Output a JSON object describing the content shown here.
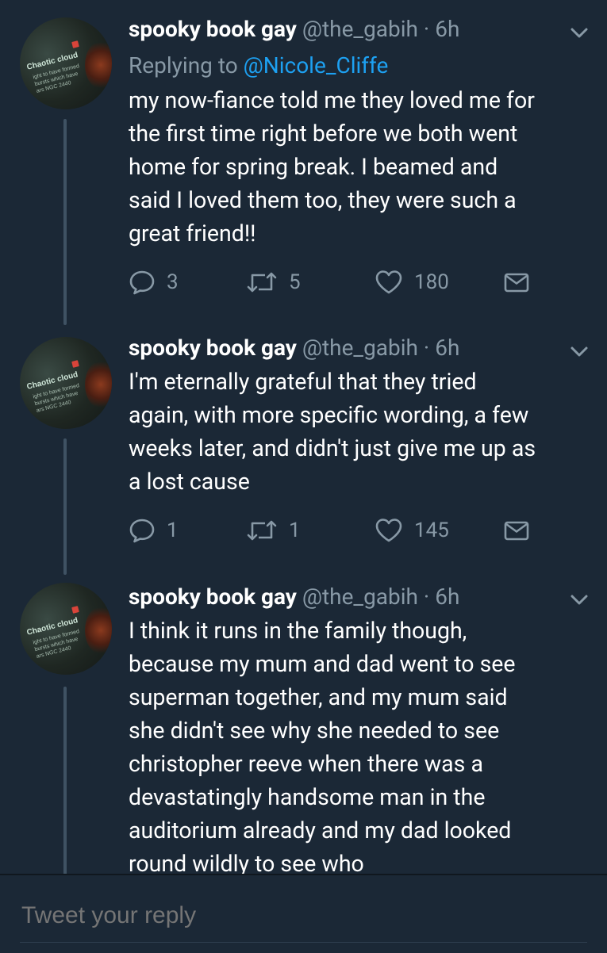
{
  "tweets": [
    {
      "name": "spooky book gay",
      "handle": "@the_gabih",
      "sep": " · ",
      "time": "6h",
      "replying_prefix": "Replying to ",
      "replying_to": "@Nicole_Cliffe",
      "lines": [
        "my now-fiance told me they loved me for",
        "the first time right before we both went",
        "home for spring break. I beamed and",
        "said I loved them too, they were such a",
        "great friend!!"
      ],
      "replies": "3",
      "retweets": "5",
      "likes": "180"
    },
    {
      "name": "spooky book gay",
      "handle": "@the_gabih",
      "sep": " · ",
      "time": "6h",
      "lines": [
        "I'm eternally grateful that they tried",
        "again, with more specific wording, a few",
        "weeks later, and didn't just give me up as",
        "a lost cause"
      ],
      "replies": "1",
      "retweets": "1",
      "likes": "145"
    },
    {
      "name": "spooky book gay",
      "handle": "@the_gabih",
      "sep": " · ",
      "time": "6h",
      "lines": [
        "I think it runs in the family though,",
        "because my mum and dad went to see",
        "superman together, and my mum said",
        "she didn't see why she needed to see",
        "christopher reeve when there was a",
        "devastatingly handsome man in the",
        "auditorium already and my dad looked",
        "round wildly to see who"
      ]
    }
  ],
  "avatar": {
    "text": "Chaotic cloud",
    "subtext": "ight to have formed\nbursts which have\nars NGC 2440"
  },
  "reply_bar": {
    "placeholder": "Tweet your reply"
  },
  "colors": {
    "background": "#1b2836",
    "secondary_text": "#8899a6",
    "mention": "#1da1f2",
    "thread_line": "#3f5263"
  },
  "icons": [
    "chevron-down-icon",
    "reply-icon",
    "retweet-icon",
    "like-icon",
    "direct-message-icon"
  ]
}
